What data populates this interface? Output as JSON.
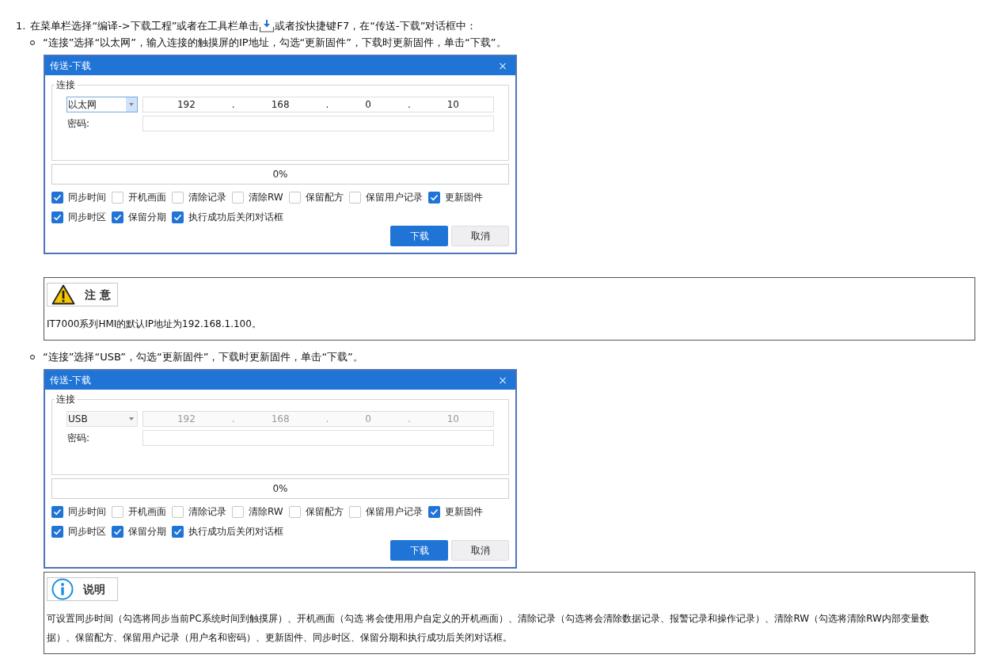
{
  "step": {
    "number": "1.",
    "text_before": "在菜单栏选择“编译->下载工程”或者在工具栏单击",
    "text_after": "或者按快捷键F7，在“传送-下载”对话框中："
  },
  "blocks": [
    {
      "kind": "bullet",
      "text": "“连接”选择“以太网”，输入连接的触摸屏的IP地址，勾选“更新固件”，下载时更新固件，单击“下载”。"
    },
    {
      "kind": "dialog",
      "title": "传送-下载",
      "close": "×",
      "group_label": "连接",
      "connection": "以太网",
      "ip_disabled": false,
      "ip": [
        "192",
        ".",
        "168",
        ".",
        "0",
        ".",
        "10"
      ],
      "password_label": "密码:",
      "progress_text": "0%",
      "level": 0,
      "option_rows": [
        [
          {
            "label": "同步时间",
            "checked": true
          },
          {
            "label": "开机画面",
            "checked": false
          },
          {
            "label": "清除记录",
            "checked": false
          },
          {
            "label": "清除RW",
            "checked": false
          },
          {
            "label": "保留配方",
            "checked": false
          },
          {
            "label": "保留用户记录",
            "checked": false
          },
          {
            "label": "更新固件",
            "checked": true
          }
        ],
        [
          {
            "label": "同步时区",
            "checked": true
          },
          {
            "label": "保留分期",
            "checked": true
          },
          {
            "label": "执行成功后关闭对话框",
            "checked": true
          }
        ]
      ],
      "buttons": [
        {
          "label": "下载",
          "primary": true
        },
        {
          "label": "取消",
          "primary": false
        }
      ]
    },
    {
      "kind": "caution_note",
      "title": "注 意",
      "text": "IT7000系列HMI的默认IP地址为192.168.1.100。"
    },
    {
      "kind": "bullet",
      "text": "“连接”选择“USB”，勾选“更新固件”，下载时更新固件，单击“下载”。"
    },
    {
      "kind": "dialog",
      "title": "传送-下载",
      "close": "×",
      "group_label": "连接",
      "connection": "USB",
      "ip_disabled": true,
      "ip": [
        "192",
        ".",
        "168",
        ".",
        "0",
        ".",
        "10"
      ],
      "password_label": "密码:",
      "progress_text": "0%",
      "level": 0,
      "option_rows": [
        [
          {
            "label": "同步时间",
            "checked": true
          },
          {
            "label": "开机画面",
            "checked": false
          },
          {
            "label": "清除记录",
            "checked": false
          },
          {
            "label": "清除RW",
            "checked": false
          },
          {
            "label": "保留配方",
            "checked": false
          },
          {
            "label": "保留用户记录",
            "checked": false
          },
          {
            "label": "更新固件",
            "checked": true
          }
        ],
        [
          {
            "label": "同步时区",
            "checked": true
          },
          {
            "label": "保留分期",
            "checked": true
          },
          {
            "label": "执行成功后关闭对话框",
            "checked": true
          }
        ]
      ],
      "buttons": [
        {
          "label": "下载",
          "primary": true
        },
        {
          "label": "取消",
          "primary": false
        }
      ]
    },
    {
      "kind": "info_note",
      "title": "说明",
      "text": "可设置同步时间（勾选将同步当前PC系统时间到触摸屏）、开机画面（勾选 将会使用用户自定义的开机画面）、清除记录（勾选将会清除数据记录、报警记录和操作记录）、清除RW（勾选将清除RW内部变量数据）、保留配方、保留用户记录（用户名和密码）、更新固件、同步时区、保留分期和执行成功后关闭对话框。"
    }
  ]
}
